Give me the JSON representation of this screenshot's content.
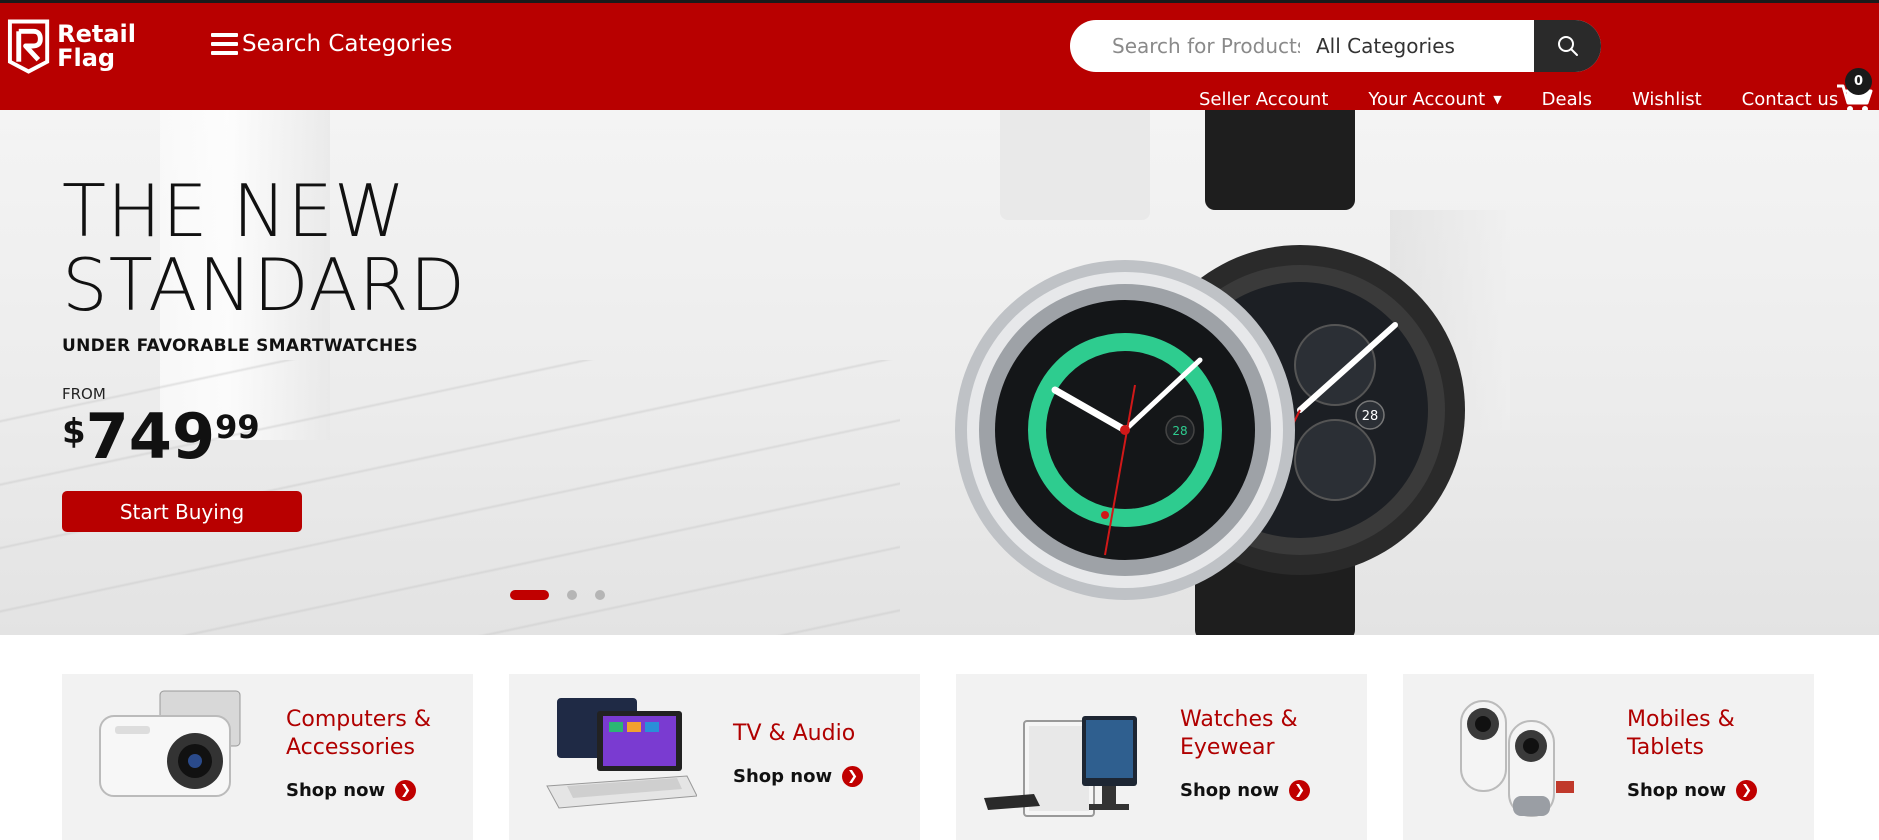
{
  "header": {
    "logo_line1": "Retail",
    "logo_line2": "Flag",
    "menu_label": "Search Categories",
    "search_placeholder": "Search for Products",
    "category_selected": "All Categories",
    "nav": [
      "Seller Account",
      "Your Account",
      "Deals",
      "Wishlist",
      "Contact us"
    ],
    "cart_count": "0"
  },
  "hero": {
    "title_line1": "THE NEW",
    "title_line2": "STANDARD",
    "subtitle": "UNDER FAVORABLE SMARTWATCHES",
    "from_label": "FROM",
    "price_currency": "$",
    "price_whole": "749",
    "price_cents": "99",
    "cta": "Start Buying",
    "watch_date": "28",
    "slide_count": 3,
    "active_slide": 1
  },
  "categories": [
    {
      "title": "Computers & Accessories",
      "cta": "Shop now"
    },
    {
      "title": "TV & Audio",
      "cta": "Shop now"
    },
    {
      "title": "Watches & Eyewear",
      "cta": "Shop now"
    },
    {
      "title": "Mobiles & Tablets",
      "cta": "Shop now"
    }
  ],
  "colors": {
    "brand_red": "#b80000",
    "dark": "#2a2a2a",
    "card_bg": "#f2f2f2",
    "accent_green": "#2ecc8f"
  },
  "icons": [
    "logo-flag-icon",
    "hamburger-icon",
    "search-icon",
    "chevron-down-icon",
    "cart-icon",
    "arrow-right-icon"
  ]
}
